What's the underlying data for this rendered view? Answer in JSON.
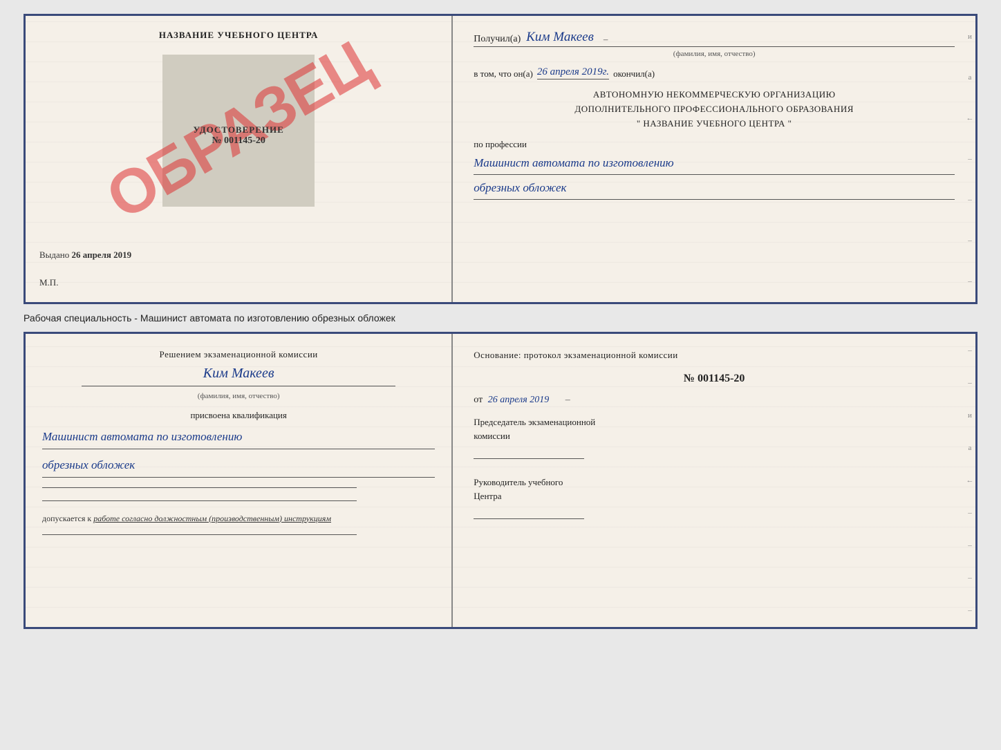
{
  "top_doc": {
    "left": {
      "training_center_title": "НАЗВАНИЕ УЧЕБНОГО ЦЕНТРА",
      "watermark": "ОБРАЗЕЦ",
      "udostoverenie_label": "УДОСТОВЕРЕНИЕ",
      "udostoverenie_number": "№ 001145-20",
      "vydano_label": "Выдано",
      "vydano_date": "26 апреля 2019",
      "mp_label": "М.П."
    },
    "right": {
      "poluchil_label": "Получил(а)",
      "recipient_name": "Ким Макеев",
      "fio_label": "(фамилия, имя, отчество)",
      "vtom_label": "в том, что он(а)",
      "completion_date": "26 апреля 2019г.",
      "okончil_label": "окончил(а)",
      "org_line1": "АВТОНОМНУЮ НЕКОММЕРЧЕСКУЮ ОРГАНИЗАЦИЮ",
      "org_line2": "ДОПОЛНИТЕЛЬНОГО ПРОФЕССИОНАЛЬНОГО ОБРАЗОВАНИЯ",
      "org_line3": "\"  НАЗВАНИЕ УЧЕБНОГО ЦЕНТРА  \"",
      "profession_label": "по профессии",
      "profession_line1": "Машинист автомата по изготовлению",
      "profession_line2": "обрезных обложек"
    }
  },
  "caption": {
    "text": "Рабочая специальность - Машинист автомата по изготовлению обрезных обложек"
  },
  "bottom_doc": {
    "left": {
      "resheniem_label": "Решением экзаменационной комиссии",
      "name_cursive": "Ким Макеев",
      "fio_label": "(фамилия, имя, отчество)",
      "prisvoena_label": "присвоена квалификация",
      "kvalif_line1": "Машинист автомата по изготовлению",
      "kvalif_line2": "обрезных обложек",
      "dopuskaetsya_label": "допускается к",
      "dopuskaetsya_text": "работе согласно должностным (производственным) инструкциям"
    },
    "right": {
      "osnov_label": "Основание: протокол экзаменационной комиссии",
      "protocol_number": "№  001145-20",
      "ot_label": "от",
      "protocol_date": "26 апреля 2019",
      "predsedatel_label": "Председатель экзаменационной",
      "predsedatel_label2": "комиссии",
      "rukovoditel_label": "Руководитель учебного",
      "rukovoditel_label2": "Центра"
    }
  }
}
